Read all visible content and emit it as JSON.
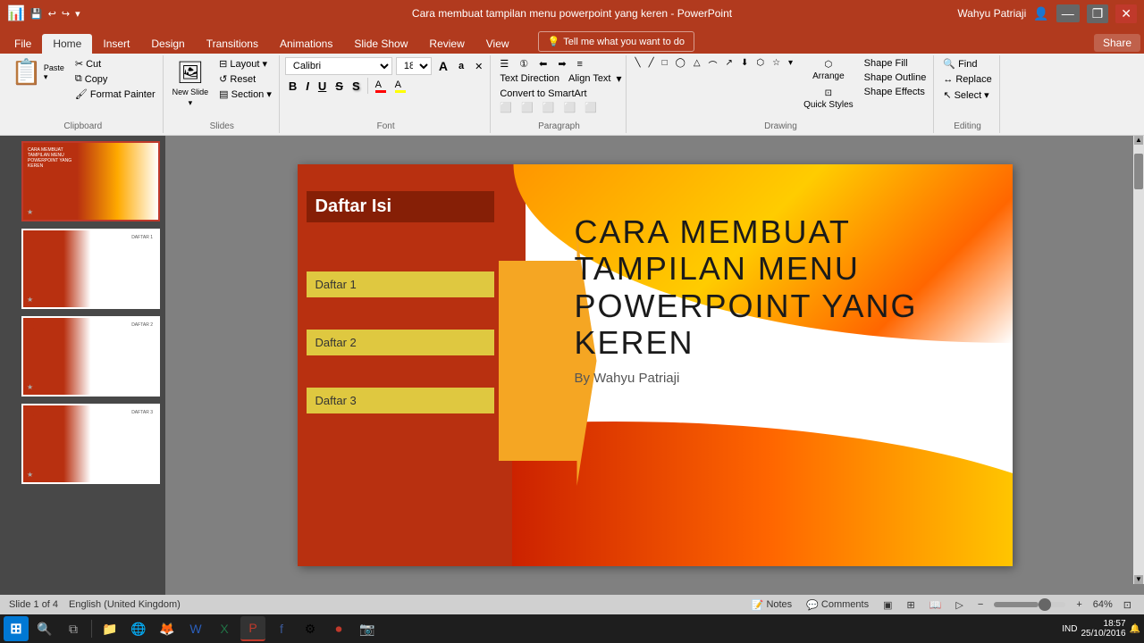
{
  "titlebar": {
    "title": "Cara membuat tampilan menu powerpoint yang keren - PowerPoint",
    "user": "Wahyu Patriaji",
    "qat": [
      "save",
      "undo",
      "redo",
      "customize"
    ],
    "window_btns": [
      "minimize",
      "restore",
      "close"
    ]
  },
  "ribbon": {
    "tabs": [
      "File",
      "Home",
      "Insert",
      "Design",
      "Transitions",
      "Animations",
      "Slide Show",
      "Review",
      "View"
    ],
    "active_tab": "Home",
    "search_placeholder": "Tell me what you want to do",
    "share_label": "Share",
    "groups": {
      "clipboard": {
        "label": "Clipboard",
        "paste": "Paste",
        "cut": "Cut",
        "copy": "Copy",
        "format_painter": "Format Painter"
      },
      "slides": {
        "label": "Slides",
        "new_slide": "New Slide",
        "layout": "Layout",
        "reset": "Reset",
        "section": "Section"
      },
      "font": {
        "label": "Font",
        "font_name": "Calibri",
        "font_size": "18",
        "grow": "A",
        "shrink": "a",
        "clear": "Clear",
        "bold": "B",
        "italic": "I",
        "underline": "U",
        "strikethrough": "S",
        "shadow": "S",
        "color": "A"
      },
      "paragraph": {
        "label": "Paragraph",
        "text_direction": "Text Direction",
        "align_text": "Align Text",
        "convert_smartart": "Convert to SmartArt",
        "bullets": "Bullets",
        "numbering": "Numbering",
        "decrease_indent": "Decrease Indent",
        "increase_indent": "Increase Indent",
        "line_spacing": "Line Spacing"
      },
      "drawing": {
        "label": "Drawing",
        "shape_fill": "Shape Fill",
        "shape_outline": "Shape Outline",
        "shape_effects": "Shape Effects",
        "arrange": "Arrange",
        "quick_styles": "Quick Styles"
      },
      "editing": {
        "label": "Editing",
        "find": "Find",
        "replace": "Replace",
        "select": "Select"
      }
    }
  },
  "slides": [
    {
      "number": 1,
      "active": true,
      "title": "CARA MEMBUAT TAMPILAN MENU POWERPOINT YANG KEREN",
      "label": ""
    },
    {
      "number": 2,
      "active": false,
      "title": "",
      "label": "DAFTAR 1"
    },
    {
      "number": 3,
      "active": false,
      "title": "",
      "label": "DAFTAR 2"
    },
    {
      "number": 4,
      "active": false,
      "title": "",
      "label": "DAFTAR 3"
    }
  ],
  "current_slide": {
    "title": "CARA MEMBUAT TAMPILAN MENU POWERPOINT YANG KEREN",
    "subtitle": "By Wahyu Patriaji",
    "menu_title": "Daftar Isi",
    "menu_items": [
      "Daftar 1",
      "Daftar 2",
      "Daftar 3"
    ]
  },
  "statusbar": {
    "slide_info": "Slide 1 of 4",
    "language": "English (United Kingdom)",
    "notes": "Notes",
    "comments": "Comments",
    "view_normal": "Normal",
    "view_slide_sorter": "Slide Sorter",
    "view_reading": "Reading",
    "view_slideshow": "Slide Show",
    "zoom_out": "-",
    "zoom_level": "64%",
    "zoom_in": "+"
  },
  "taskbar": {
    "time": "18:57",
    "date": "25/10/2016",
    "apps": [
      "⊞",
      "⬛",
      "🌐",
      "🔵",
      "📁",
      "🦊",
      "📄",
      "📊",
      "🔴",
      "📎",
      "⚙️"
    ],
    "language": "IND"
  }
}
